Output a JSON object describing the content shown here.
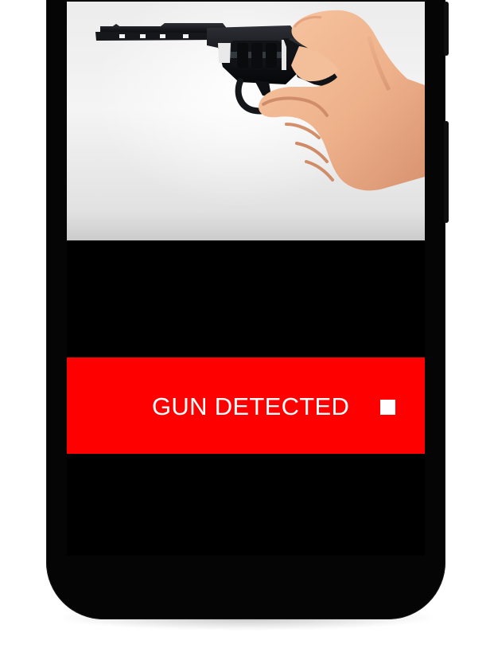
{
  "screen": {
    "background_color": "#000000",
    "camera_feed": {
      "icon": "revolver-in-hand-photo"
    },
    "alert_banner": {
      "label": "GUN DETECTED",
      "background_color": "#ff0000",
      "text_color": "#ffffff",
      "stop_icon": "stop-icon"
    }
  }
}
